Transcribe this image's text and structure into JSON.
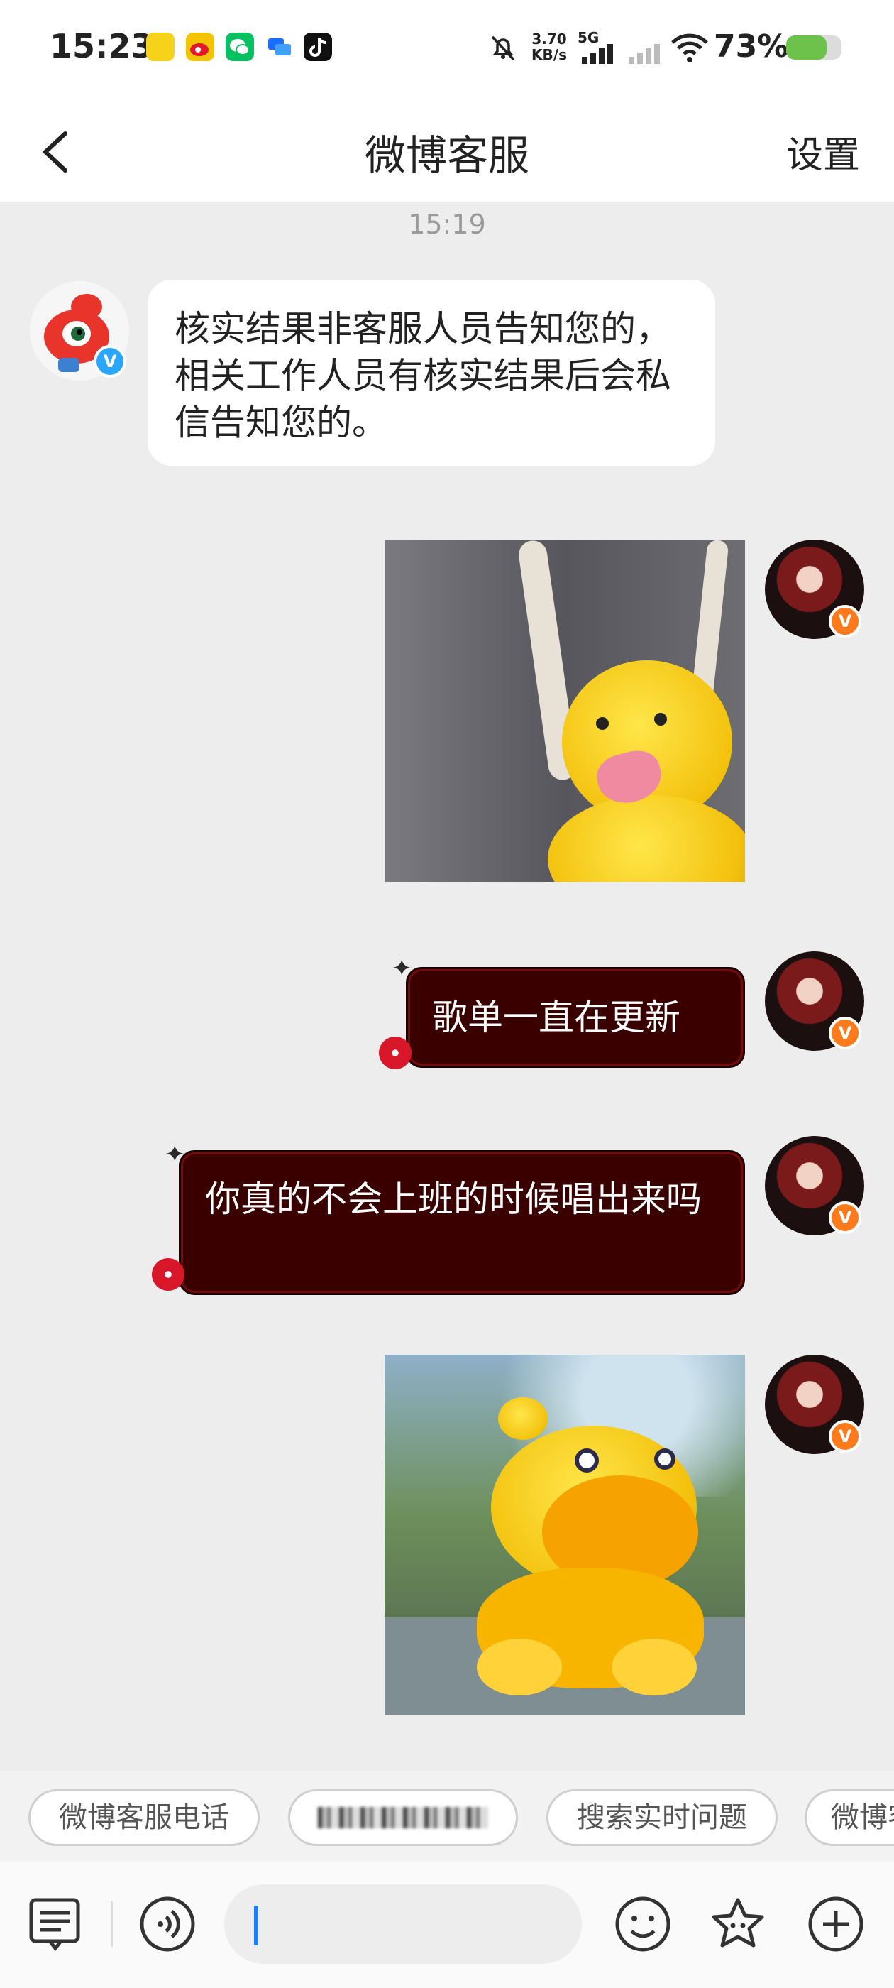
{
  "status_bar": {
    "time": "15:23",
    "net_speed_value": "3.70",
    "net_speed_unit": "KB/s",
    "network_type": "5G",
    "battery": "73%",
    "battery_level": 0.73,
    "notification_icons": [
      "app-music-icon",
      "weibo-icon",
      "wechat-icon",
      "chat-icon",
      "tiktok-icon"
    ]
  },
  "header": {
    "title": "微博客服",
    "settings_label": "设置"
  },
  "chat": {
    "timestamp": "15:19",
    "messages": [
      {
        "from": "service",
        "type": "text",
        "text": "核实结果非客服人员告知您的，相关工作人员有核实结果后会私信告知您的。"
      },
      {
        "from": "user",
        "type": "sticker"
      },
      {
        "from": "user",
        "type": "text",
        "text": "歌单一直在更新"
      },
      {
        "from": "user",
        "type": "text",
        "text": "你真的不会上班的时候唱出来吗"
      },
      {
        "from": "user",
        "type": "sticker"
      }
    ],
    "verified_badge_user": "V",
    "verified_badge_service": "V"
  },
  "quick_replies": [
    {
      "label": "微博客服电话"
    },
    {
      "label": ""
    },
    {
      "label": "搜索实时问题"
    },
    {
      "label": "微博客"
    }
  ],
  "colors": {
    "accent_blue": "#1a7ef5",
    "bubble_dark": "#3a0000",
    "badge_orange": "#ff7a1a",
    "battery_green": "#6cc24a"
  }
}
